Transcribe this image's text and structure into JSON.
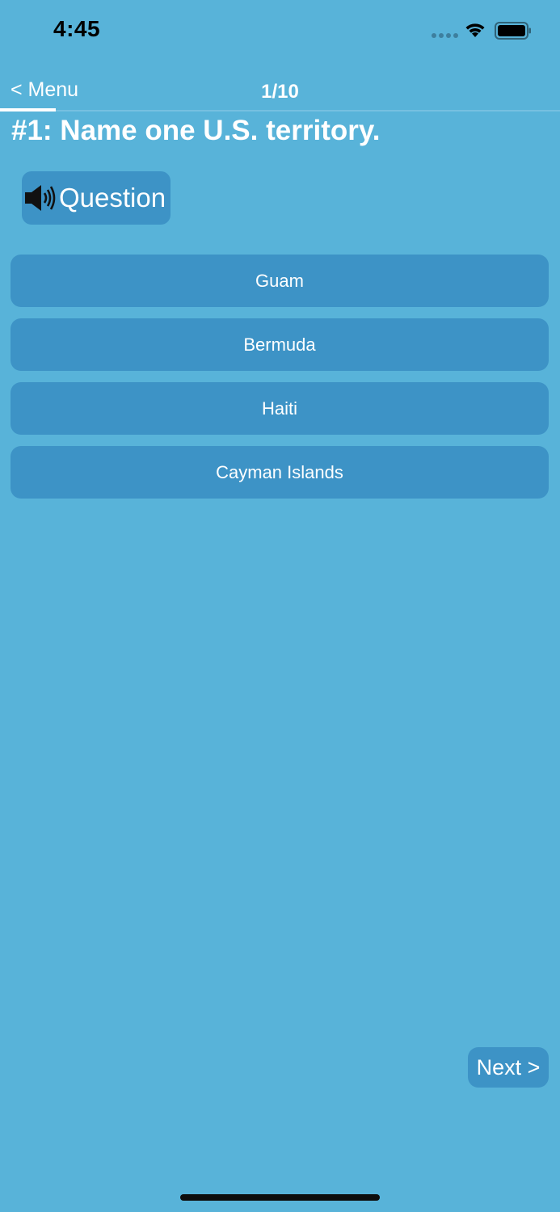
{
  "status_bar": {
    "time": "4:45",
    "signal_icon": "signal-dots-icon",
    "wifi_icon": "wifi-icon",
    "battery_icon": "battery-icon"
  },
  "nav": {
    "back_label": "< Menu",
    "counter": "1/10",
    "progress_fraction": 0.1
  },
  "question": {
    "title": "#1: Name one U.S. territory.",
    "audio_label": "Question",
    "audio_icon": "speaker-icon"
  },
  "answers": [
    {
      "label": "Guam"
    },
    {
      "label": "Bermuda"
    },
    {
      "label": "Haiti"
    },
    {
      "label": "Cayman Islands"
    }
  ],
  "footer": {
    "next_label": "Next >"
  },
  "colors": {
    "background": "#58b3d9",
    "button": "#3d93c6",
    "text": "#ffffff"
  }
}
